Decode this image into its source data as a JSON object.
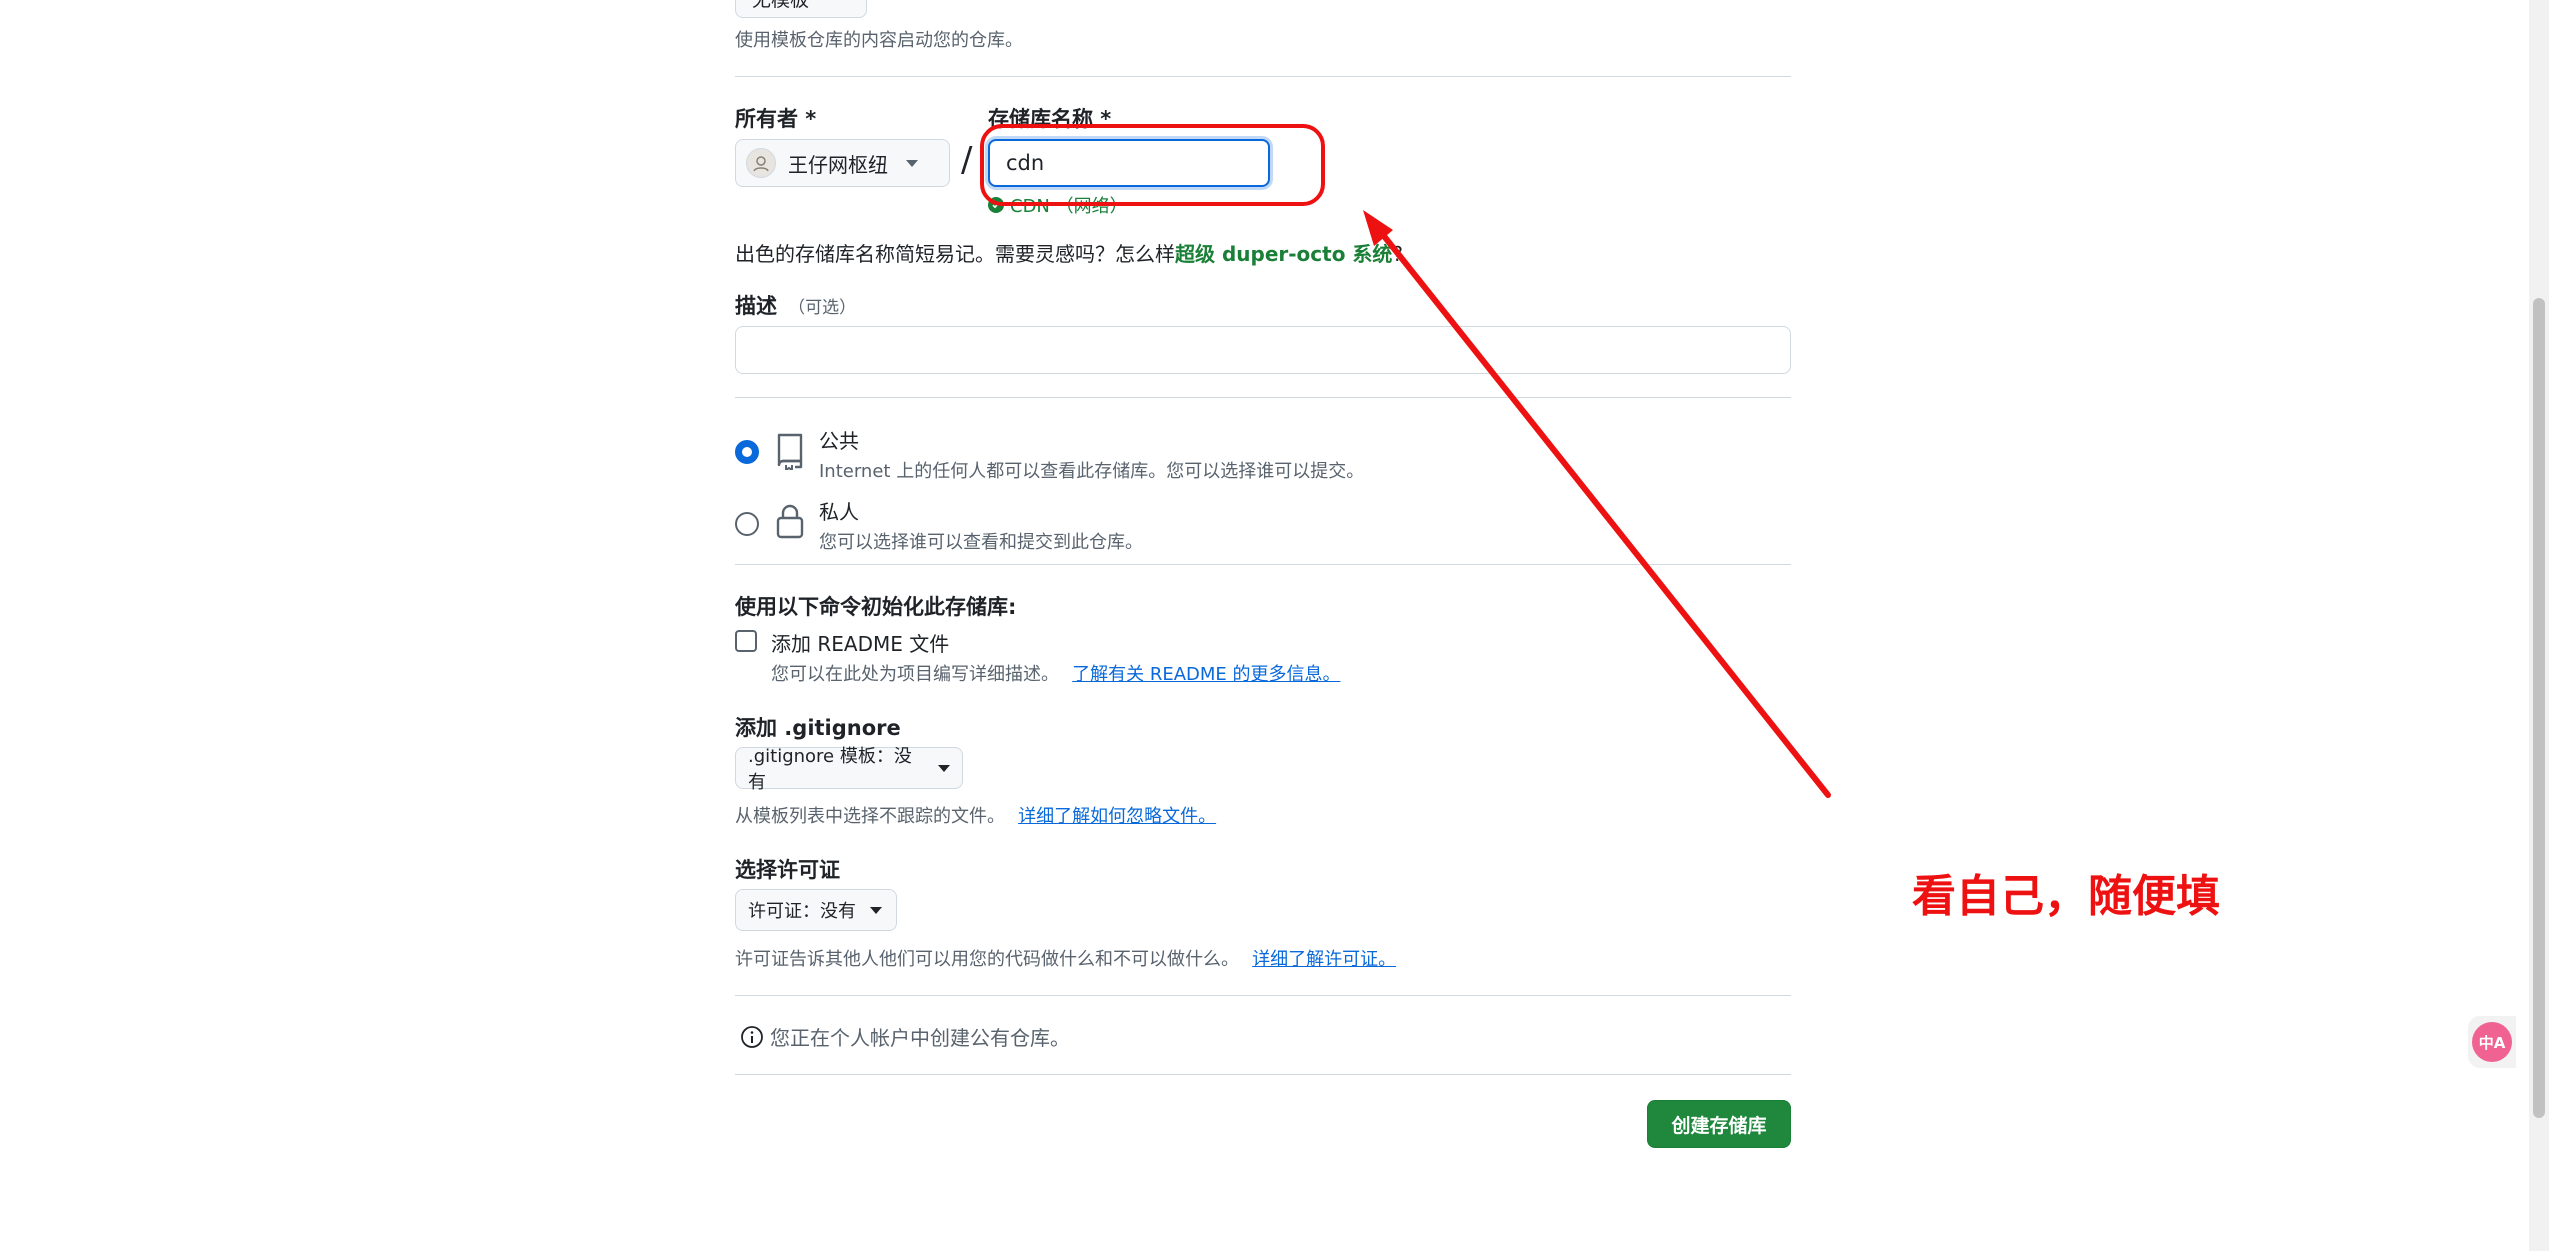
{
  "template": {
    "button_label": "无模板",
    "hint": "使用模板仓库的内容启动您的仓库。"
  },
  "owner": {
    "label": "所有者 *",
    "value": "王仔网枢纽"
  },
  "slash": "/",
  "repo_name": {
    "label": "存储库名称 *",
    "value": "cdn",
    "availability": "CDN （网络）"
  },
  "name_tip": {
    "prefix": "出色的存储库名称简短易记。需要灵感吗？怎么样",
    "suggestion": "超级 duper-octo 系统",
    "suffix": "?"
  },
  "description": {
    "label": "描述",
    "optional": "（可选）",
    "value": ""
  },
  "visibility": {
    "public": {
      "title": "公共",
      "desc": "Internet 上的任何人都可以查看此存储库。您可以选择谁可以提交。",
      "selected": true
    },
    "private": {
      "title": "私人",
      "desc": "您可以选择谁可以查看和提交到此仓库。",
      "selected": false
    }
  },
  "init": {
    "heading": "使用以下命令初始化此存储库:",
    "readme_label": "添加 README 文件",
    "readme_checked": false,
    "readme_hint": "您可以在此处为项目编写详细描述。",
    "readme_link": "了解有关 README 的更多信息。"
  },
  "gitignore": {
    "heading": "添加 .gitignore",
    "select_label": ".gitignore 模板：没有",
    "hint": "从模板列表中选择不跟踪的文件。",
    "link": "详细了解如何忽略文件。"
  },
  "license": {
    "heading": "选择许可证",
    "select_label": "许可证：没有",
    "hint": "许可证告诉其他人他们可以用您的代码做什么和不可以做什么。",
    "link": "详细了解许可证。"
  },
  "notice": "您正在个人帐户中创建公有仓库。",
  "create_button": "创建存储库",
  "annotation": {
    "text": "看自己，随便填",
    "color": "#ee1111"
  },
  "translate_widget_label": "中A",
  "colors": {
    "primary_green": "#1f883d",
    "focus_blue": "#0969da",
    "suggestion_green": "#1a7f37"
  }
}
